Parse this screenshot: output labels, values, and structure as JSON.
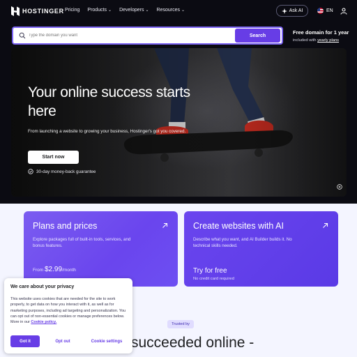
{
  "nav": {
    "brand": "HOSTINGER",
    "menu": [
      {
        "label": "Pricing",
        "has_dropdown": false
      },
      {
        "label": "Products",
        "has_dropdown": true
      },
      {
        "label": "Developers",
        "has_dropdown": true
      },
      {
        "label": "Resources",
        "has_dropdown": true
      }
    ],
    "ask_ai": "Ask AI",
    "language": "EN"
  },
  "search": {
    "placeholder": "Type the domain you want",
    "button": "Search"
  },
  "promo": {
    "title": "Free domain for 1 year",
    "sub_prefix": "included with",
    "sub_link": "yearly plans"
  },
  "hero": {
    "title": "Your online success starts here",
    "description": "From launching a website to growing your business, Hostinger's got you covered.",
    "cta": "Start now",
    "guarantee": "30-day money-back guarantee"
  },
  "cards": [
    {
      "title": "Plans and prices",
      "description": "Explore packages full of built-in tools, services, and bonus features.",
      "price_prefix": "From",
      "price": "$2.99",
      "price_suffix": "/month"
    },
    {
      "title": "Create websites with AI",
      "description": "Describe what you want, and AI Builder builds it. No technical skills needed.",
      "cta": "Try for free",
      "note": "No credit card required"
    }
  ],
  "trusted_badge": "Trusted by",
  "headline": "succeeded online -",
  "cookie": {
    "title": "We care about your privacy",
    "body": "This website uses cookies that are needed for the site to work properly, to get data on how you interact with it, as well as for marketing purposes, including ad targeting and personalization. You can opt out of non-essential cookies or manage preferences below. More in our",
    "link": "Cookie policy.",
    "got_it": "Got it",
    "opt_out": "Opt out",
    "settings": "Cookie settings"
  },
  "colors": {
    "brand_purple": "#673de6",
    "page_dark": "#0b0b12",
    "light_section": "#f4f5ff"
  }
}
